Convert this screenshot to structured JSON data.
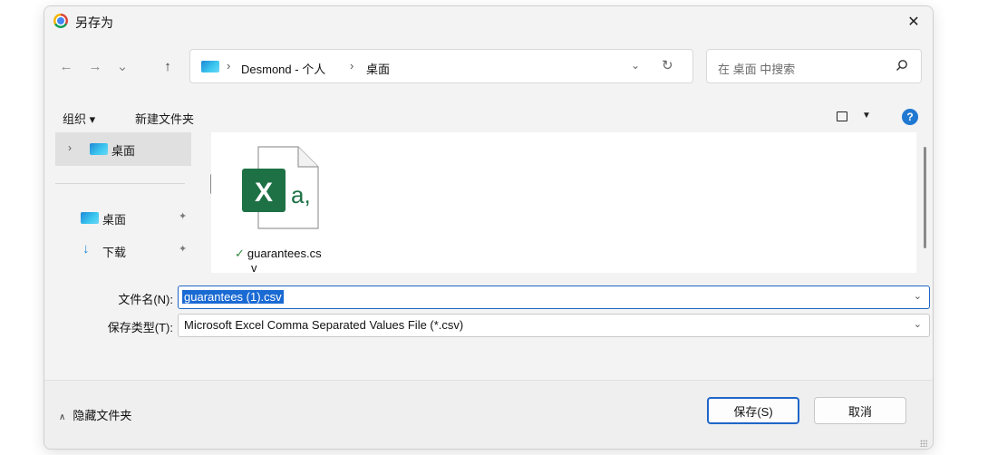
{
  "window": {
    "title": "另存为",
    "close_glyph": "✕"
  },
  "nav": {
    "back_glyph": "←",
    "forward_glyph": "→",
    "recent_glyph": "⌄",
    "up_glyph": "↑",
    "breadcrumb": [
      "Desmond - 个人",
      "桌面"
    ],
    "breadcrumb_sep": "›",
    "dropdown_glyph": "⌄",
    "refresh_glyph": "↻"
  },
  "search": {
    "placeholder": "在 桌面 中搜索"
  },
  "toolbar": {
    "organize": "组织 ▾",
    "new_folder": "新建文件夹",
    "help_glyph": "?"
  },
  "sidebar": {
    "expand_glyph": "›",
    "selected": "桌面",
    "items": [
      {
        "label": "桌面",
        "icon": "desktop-folder-icon",
        "pin": "📌"
      },
      {
        "label": "下载",
        "icon": "download-icon",
        "pin": "📌"
      }
    ],
    "download_glyph": "↓"
  },
  "files": [
    {
      "name": "guarantees.cs",
      "name_wrap": "v",
      "icon": "excel-csv-icon",
      "status_icon": "✓"
    }
  ],
  "fields": {
    "filename_label": "文件名(N):",
    "filename_value": "guarantees (1).csv",
    "filetype_label": "保存类型(T):",
    "filetype_value": "Microsoft Excel Comma Separated Values File (*.csv)",
    "dropdown_glyph": "⌄"
  },
  "footer": {
    "hide_folders": "隐藏文件夹",
    "hide_caret": "∧",
    "save_label": "保存(S)",
    "cancel_label": "取消"
  },
  "colors": {
    "accent": "#1f66c7",
    "excel_green": "#1e7145",
    "selection": "#1a6ad3"
  }
}
